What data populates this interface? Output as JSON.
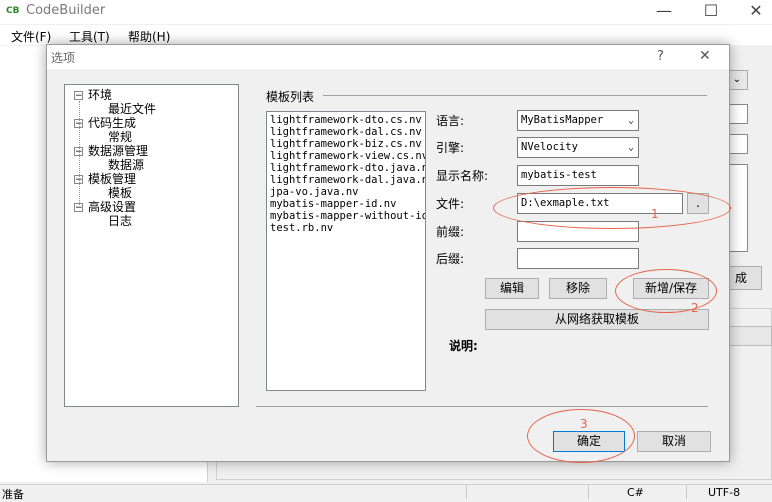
{
  "app": {
    "title": "CodeBuilder",
    "icon": "app-logo-icon"
  },
  "menu": [
    "文件(F)",
    "工具(T)",
    "帮助(H)"
  ],
  "status": {
    "left": "准备",
    "lang": "C#",
    "encoding": "UTF-8"
  },
  "main_right": {
    "button_fragment": "成"
  },
  "dialog": {
    "title": "选项",
    "help_symbol": "?",
    "close_symbol": "✕",
    "tree": [
      {
        "label": "环境",
        "children": [
          "最近文件"
        ]
      },
      {
        "label": "代码生成",
        "children": [
          "常规"
        ]
      },
      {
        "label": "数据源管理",
        "children": [
          "数据源"
        ]
      },
      {
        "label": "模板管理",
        "children": [
          "模板"
        ]
      },
      {
        "label": "高级设置",
        "children": [
          "日志"
        ]
      }
    ],
    "template_list_label": "模板列表",
    "templates": [
      "lightframework-dto.cs.nv",
      "lightframework-dal.cs.nv",
      "lightframework-biz.cs.nv",
      "lightframework-view.cs.nv",
      "lightframework-dto.java.nv",
      "lightframework-dal.java.nv",
      "jpa-vo.java.nv",
      "mybatis-mapper-id.nv",
      "mybatis-mapper-without-id.",
      "test.rb.nv"
    ],
    "fields": {
      "language_label": "语言:",
      "language_value": "MyBatisMapper",
      "engine_label": "引擎:",
      "engine_value": "NVelocity",
      "display_name_label": "显示名称:",
      "display_name_value": "mybatis-test",
      "file_label": "文件:",
      "file_value": "D:\\exmaple.txt",
      "browse_label": ".",
      "prefix_label": "前缀:",
      "prefix_value": "",
      "suffix_label": "后缀:",
      "suffix_value": ""
    },
    "buttons": {
      "edit": "编辑",
      "remove": "移除",
      "add_save": "新增/保存",
      "fetch_online": "从网络获取模板",
      "ok": "确定",
      "cancel": "取消"
    },
    "description_label": "说明:",
    "annotations": [
      "1",
      "2",
      "3"
    ]
  }
}
